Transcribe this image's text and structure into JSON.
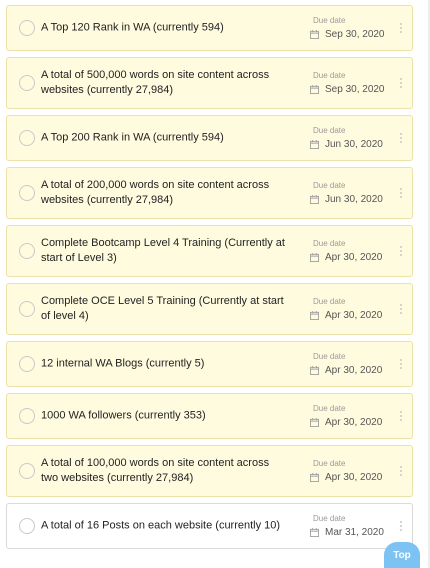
{
  "tasks": [
    {
      "title": "A Top 120 Rank in WA (currently 594)",
      "due_label": "Due date",
      "due_date": "Sep 30, 2020",
      "style": "yellow"
    },
    {
      "title": "A total of 500,000 words on site content across websites (currently 27,984)",
      "due_label": "Due date",
      "due_date": "Sep 30, 2020",
      "style": "yellow"
    },
    {
      "title": "A Top 200 Rank in WA (currently 594)",
      "due_label": "Due date",
      "due_date": "Jun 30, 2020",
      "style": "yellow"
    },
    {
      "title": "A total of 200,000 words on site content across websites (currently 27,984)",
      "due_label": "Due date",
      "due_date": "Jun 30, 2020",
      "style": "yellow"
    },
    {
      "title": "Complete Bootcamp Level 4 Training (Currently at start of Level 3)",
      "due_label": "Due date",
      "due_date": "Apr 30, 2020",
      "style": "yellow"
    },
    {
      "title": "Complete OCE Level 5 Training (Currently at start of level 4)",
      "due_label": "Due date",
      "due_date": "Apr 30, 2020",
      "style": "yellow"
    },
    {
      "title": "12 internal WA Blogs (currently 5)",
      "due_label": "Due date",
      "due_date": "Apr 30, 2020",
      "style": "yellow"
    },
    {
      "title": "1000 WA followers (currently 353)",
      "due_label": "Due date",
      "due_date": "Apr 30, 2020",
      "style": "yellow"
    },
    {
      "title": "A total of 100,000 words on site content across two websites (currently 27,984)",
      "due_label": "Due date",
      "due_date": "Apr 30, 2020",
      "style": "yellow"
    },
    {
      "title": "A total of 16 Posts on each website (currently 10)",
      "due_label": "Due date",
      "due_date": "Mar 31, 2020",
      "style": "white"
    }
  ],
  "top_button": {
    "label": "Top"
  },
  "colors": {
    "card_yellow": "#fffbdf",
    "card_border": "#ece1a6",
    "accent": "#7cc3f3"
  }
}
